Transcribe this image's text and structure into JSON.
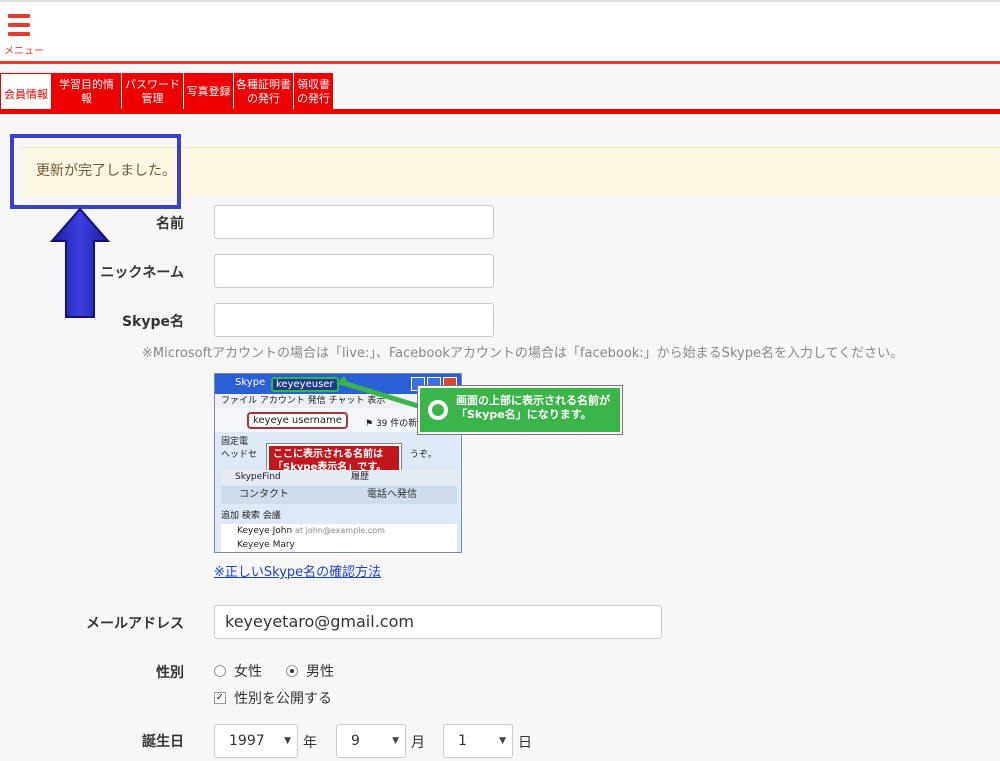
{
  "header": {
    "menu_label": "メニュー",
    "menu_icon": "hamburger-icon"
  },
  "tabs": [
    {
      "label": "会員情報",
      "active": true
    },
    {
      "label": "学習目的情報"
    },
    {
      "label": "パスワード\n管理"
    },
    {
      "label": "写真登録"
    },
    {
      "label": "各種証明書\nの発行"
    },
    {
      "label": "領収書\nの発行"
    }
  ],
  "alert": {
    "message": "更新が完了しました。"
  },
  "form": {
    "name_label": "名前",
    "nickname_label": "ニックネーム",
    "skype_label": "Skype名",
    "skype_hint": "※Microsoftアカウントの場合は「live:」、Facebookアカウントの場合は「facebook:」から始まるSkype名を入力してください。",
    "skype_help_link": "※正しいSkype名の確認方法",
    "email_label": "メールアドレス",
    "email_value": "keyeyetaro@gmail.com",
    "gender_label": "性別",
    "gender_female": "女性",
    "gender_male": "男性",
    "gender_public": "性別を公開する",
    "birthday_label": "誕生日",
    "birth_year": "1997",
    "year_unit": "年",
    "birth_month": "9",
    "month_unit": "月",
    "birth_day": "1",
    "day_unit": "日"
  },
  "skype_image": {
    "title": "Skype",
    "username_top": "keyeyeuser",
    "menu_text": "ファイル アカウント 発信 チャット 表示",
    "display_name": "keyeye username",
    "flag_text": "39 件の新...",
    "line1": "固定電",
    "line2": "ヘッドセ",
    "line2_tail": "うぞ。",
    "red_callout": "ここに表示される名前は\n「Skype表示名」です。",
    "skypefind": "SkypeFind",
    "history": "履歴",
    "contacts_tab": "コンタクト",
    "call_tab": "電話へ発信",
    "actions": "追加  検索  会議",
    "contact1": "Keyeye John",
    "contact1_email": "at john@example.com",
    "contact2": "Keyeye Mary"
  },
  "green_callout": "画面の上部に表示される名前が\n「Skype名」になります。",
  "colors": {
    "accent": "#e00000",
    "alert_bg": "#fcf8e3",
    "frame": "#3b3fcf",
    "link": "#1a3fd6"
  }
}
